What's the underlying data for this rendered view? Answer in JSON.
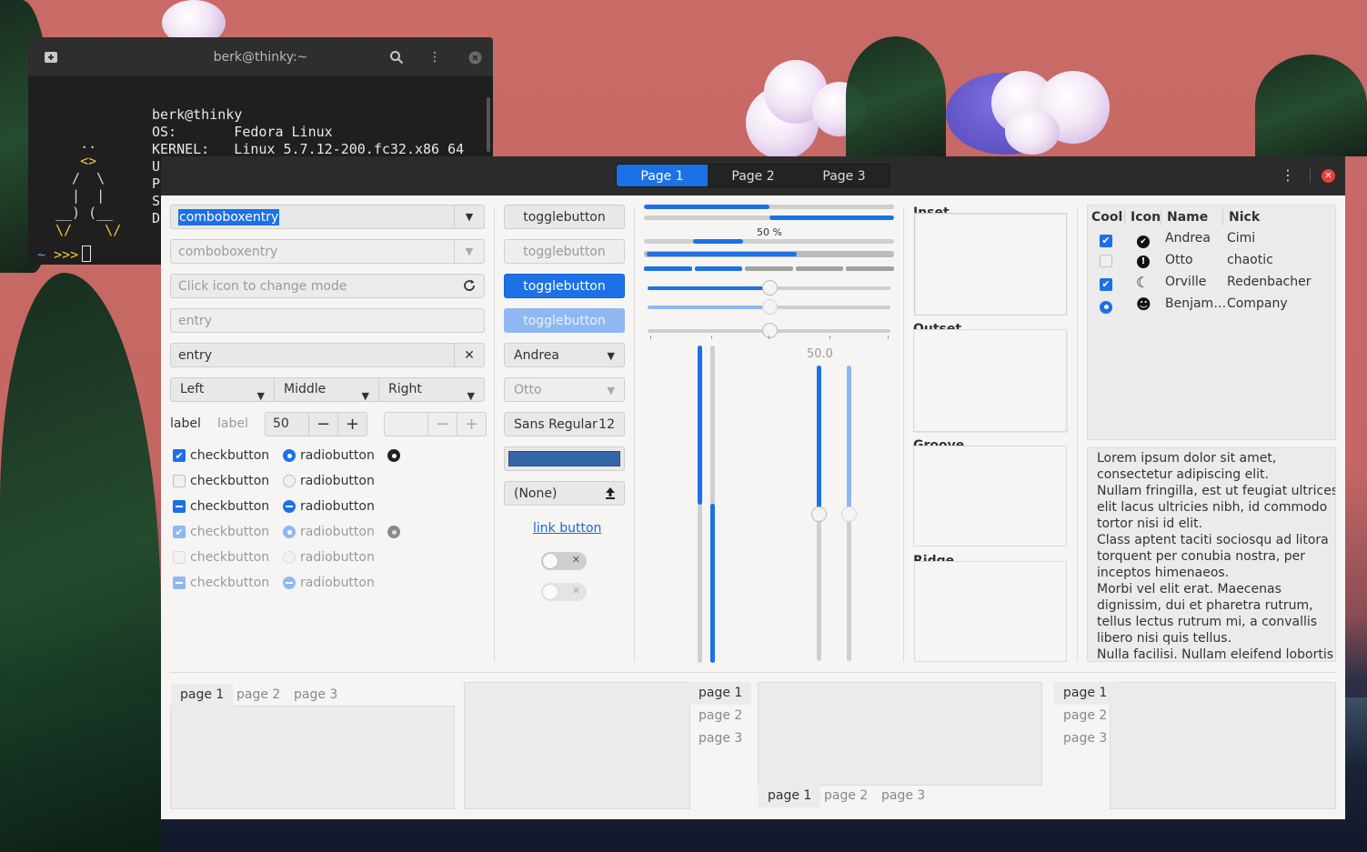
{
  "terminal": {
    "title": "berk@thinky:~",
    "ascii_lines": [
      "",
      "   ..",
      "   <>",
      "  /  \\",
      "  |  |",
      "__) (__",
      "\\/    \\/"
    ],
    "info_lines": [
      "berk@thinky",
      "OS:       Fedora Linux",
      "KERNEL:   Linux 5.7.12-200.fc32.x86_64",
      "U",
      "P",
      "S",
      "D"
    ],
    "prompt_tilde": "~",
    "prompt_arrows": ">>>"
  },
  "window": {
    "stack_switcher": [
      "Page 1",
      "Page 2",
      "Page 3"
    ],
    "active_page": "Page 1"
  },
  "col1": {
    "combo_selected": "comboboxentry",
    "combo_disabled": "comboboxentry",
    "mode_placeholder": "Click icon to change mode",
    "entry_disabled": "entry",
    "entry_clear": "entry",
    "linked": [
      "Left",
      "Middle",
      "Right"
    ],
    "label_a": "label",
    "label_b": "label",
    "spin_value": "50",
    "checks": [
      "checkbutton",
      "checkbutton",
      "checkbutton",
      "checkbutton",
      "checkbutton",
      "checkbutton"
    ],
    "radios": [
      "radiobutton",
      "radiobutton",
      "radiobutton",
      "radiobutton",
      "radiobutton",
      "radiobutton"
    ]
  },
  "col2": {
    "toggle": [
      "togglebutton",
      "togglebutton",
      "togglebutton",
      "togglebutton"
    ],
    "combo_andrea": "Andrea",
    "combo_otto": "Otto",
    "font_name": "Sans Regular",
    "font_size": "12",
    "color_hex": "#3465a4",
    "file_none": "(None)",
    "link": "link button"
  },
  "col3": {
    "progress_label": "50 %",
    "scale_value": "50.0",
    "progress": [
      0.5,
      0.5,
      0.2,
      0.6
    ],
    "h_scales": [
      0.5,
      0.5,
      0.5
    ],
    "v_scales": [
      0.5,
      0.5
    ]
  },
  "frames": [
    "Inset",
    "Outset",
    "Groove",
    "Ridge"
  ],
  "tree": {
    "headers": [
      "Cool",
      "Icon",
      "Name",
      "Nick"
    ],
    "rows": [
      {
        "name": "Andrea",
        "nick": "Cimi",
        "icon": "check-circle-icon",
        "glyph": "✔"
      },
      {
        "name": "Otto",
        "nick": "chaotic",
        "icon": "exclamation-circle-icon",
        "glyph": "!"
      },
      {
        "name": "Orville",
        "nick": "Redenbacher",
        "icon": "moon-icon",
        "glyph": "☾"
      },
      {
        "name": "Benjam…",
        "nick": "Company",
        "icon": "face-icon",
        "glyph": "☻"
      }
    ]
  },
  "textview": [
    "Lorem ipsum dolor sit amet,",
    "consectetur adipiscing elit.",
    "Nullam fringilla, est ut feugiat ultrices,",
    "elit lacus ultricies nibh, id commodo",
    "tortor nisi id elit.",
    "Class aptent taciti sociosqu ad litora",
    "torquent per conubia nostra, per",
    "inceptos himenaeos.",
    "Morbi vel elit erat. Maecenas",
    "dignissim, dui et pharetra rutrum,",
    "tellus lectus rutrum mi, a convallis",
    "libero nisi quis tellus.",
    "Nulla facilisi. Nullam eleifend lobortis"
  ],
  "notebook_tabs": [
    "page 1",
    "page 2",
    "page 3"
  ],
  "colors": {
    "accent": "#1c71e6",
    "headerbar": "#2b2b2b",
    "close": "#e8403a"
  }
}
